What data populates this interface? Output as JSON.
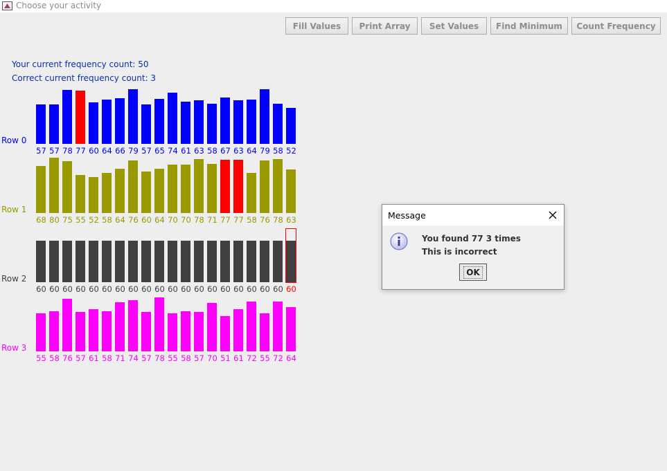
{
  "window": {
    "title": "Choose your activity"
  },
  "toolbar": {
    "buttons": [
      "Fill Values",
      "Print Array",
      "Set Values",
      "Find Minimum",
      "Count Frequency"
    ]
  },
  "info": {
    "your_count": "Your current frequency count: 50",
    "correct_count": "Correct current frequency count: 3"
  },
  "rows": [
    {
      "label": "Row 0",
      "color": "#0000ff",
      "values": [
        57,
        57,
        78,
        77,
        60,
        64,
        66,
        79,
        57,
        65,
        74,
        61,
        63,
        58,
        67,
        63,
        64,
        79,
        58,
        52
      ],
      "highlight": [
        3
      ]
    },
    {
      "label": "Row 1",
      "color": "#999900",
      "values": [
        68,
        80,
        75,
        55,
        52,
        58,
        64,
        76,
        60,
        64,
        70,
        70,
        78,
        71,
        77,
        77,
        58,
        76,
        78,
        63
      ],
      "highlight": [
        14,
        15
      ]
    },
    {
      "label": "Row 2",
      "color": "#404040",
      "values": [
        60,
        60,
        60,
        60,
        60,
        60,
        60,
        60,
        60,
        60,
        60,
        60,
        60,
        60,
        60,
        60,
        60,
        60,
        60,
        60
      ],
      "selected": 19
    },
    {
      "label": "Row 3",
      "color": "#ff00ff",
      "values": [
        55,
        58,
        76,
        57,
        61,
        58,
        71,
        74,
        57,
        78,
        55,
        58,
        57,
        70,
        51,
        61,
        72,
        55,
        72,
        64
      ]
    }
  ],
  "highlight_color": "#ff0000",
  "dialog": {
    "title": "Message",
    "line1": "You found 77 3 times",
    "line2": "This is incorrect",
    "ok_label": "OK"
  }
}
